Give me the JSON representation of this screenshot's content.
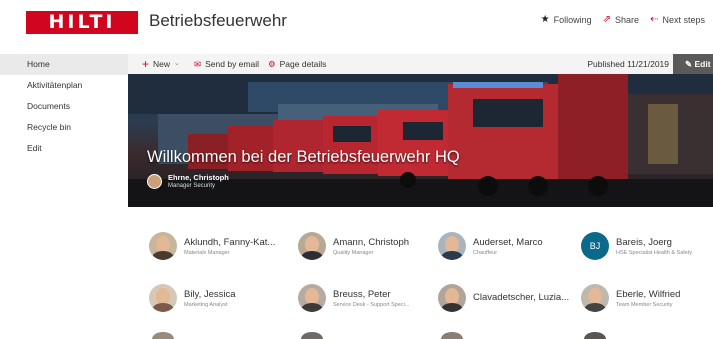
{
  "header": {
    "logo_text": "HILTI",
    "site_title": "Betriebsfeuerwehr",
    "actions": [
      {
        "label": "Following",
        "icon": "star-icon"
      },
      {
        "label": "Share",
        "icon": "share-icon"
      },
      {
        "label": "Next steps",
        "icon": "next-steps-icon"
      }
    ]
  },
  "leftnav": {
    "items": [
      {
        "label": "Home"
      },
      {
        "label": "Aktivitätenplan"
      },
      {
        "label": "Documents"
      },
      {
        "label": "Recycle bin"
      },
      {
        "label": "Edit"
      }
    ]
  },
  "commandbar": {
    "new_label": "New",
    "send_label": "Send by email",
    "details_label": "Page details",
    "published": "Published 11/21/2019",
    "edit_label": "Edit"
  },
  "hero": {
    "title": "Willkommen bei der Betriebsfeuerwehr HQ",
    "author_name": "Ehrne, Christoph",
    "author_role": "Manager Security"
  },
  "people": [
    {
      "name": "Aklundh, Fanny-Kat...",
      "role": "Materials Manager"
    },
    {
      "name": "Amann, Christoph",
      "role": "Quality Manager"
    },
    {
      "name": "Auderset, Marco",
      "role": "Chauffeur"
    },
    {
      "name": "Bareis, Joerg",
      "role": "HSE Specialist Health & Safety",
      "initials": "BJ"
    },
    {
      "name": "Bily, Jessica",
      "role": "Marketing Analyst"
    },
    {
      "name": "Breuss, Peter",
      "role": "Service Desk - Support Speci..."
    },
    {
      "name": "Clavadetscher, Luzia...",
      "role": ""
    },
    {
      "name": "Eberle, Wilfried",
      "role": "Team Member Security"
    }
  ],
  "colors": {
    "brand": "#d2051e",
    "initials_avatar": "#0b6a8a"
  }
}
